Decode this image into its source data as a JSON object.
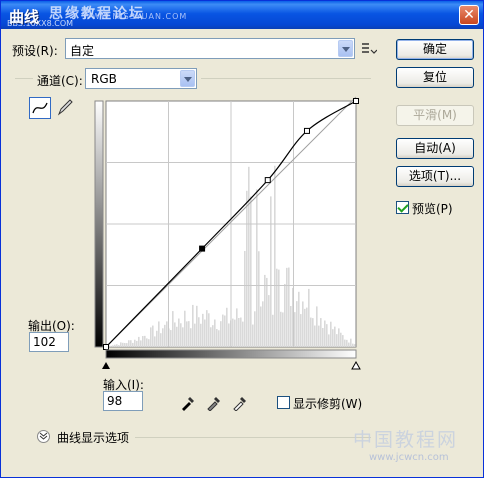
{
  "window": {
    "title": "曲线",
    "watermark_top": "思缘教程论坛",
    "watermark_url": "WWW.MISSYUAN.COM",
    "watermark_small": "BBS.16XX8.COM"
  },
  "preset": {
    "label": "预设(R):",
    "value": "自定"
  },
  "channel": {
    "label": "通道(C):",
    "value": "RGB"
  },
  "buttons": {
    "ok": "确定",
    "reset": "复位",
    "smooth": "平滑(M)",
    "auto": "自动(A)",
    "options": "选项(T)..."
  },
  "preview": {
    "label": "预览(P)",
    "checked": true
  },
  "output": {
    "label": "输出(O):",
    "value": "102"
  },
  "input": {
    "label": "输入(I):",
    "value": "98"
  },
  "show_clipping": {
    "label": "显示修剪(W)",
    "checked": false
  },
  "curve_display_options": {
    "label": "曲线显示选项"
  },
  "icons": {
    "curve_tool": "curve-icon",
    "pencil_tool": "pencil-icon",
    "preset_menu": "preset-menu-icon",
    "black_point": "eyedropper-black-icon",
    "gray_point": "eyedropper-gray-icon",
    "white_point": "eyedropper-white-icon",
    "expand": "chevron-down-icon"
  },
  "curve": {
    "points": [
      [
        0,
        0
      ],
      [
        98,
        102
      ],
      [
        165,
        173
      ],
      [
        205,
        224
      ],
      [
        255,
        255
      ]
    ],
    "selected_point": [
      98,
      102
    ]
  },
  "watermark_bottom": {
    "text": "中国教程网",
    "url": "www.jcwcn.com"
  }
}
